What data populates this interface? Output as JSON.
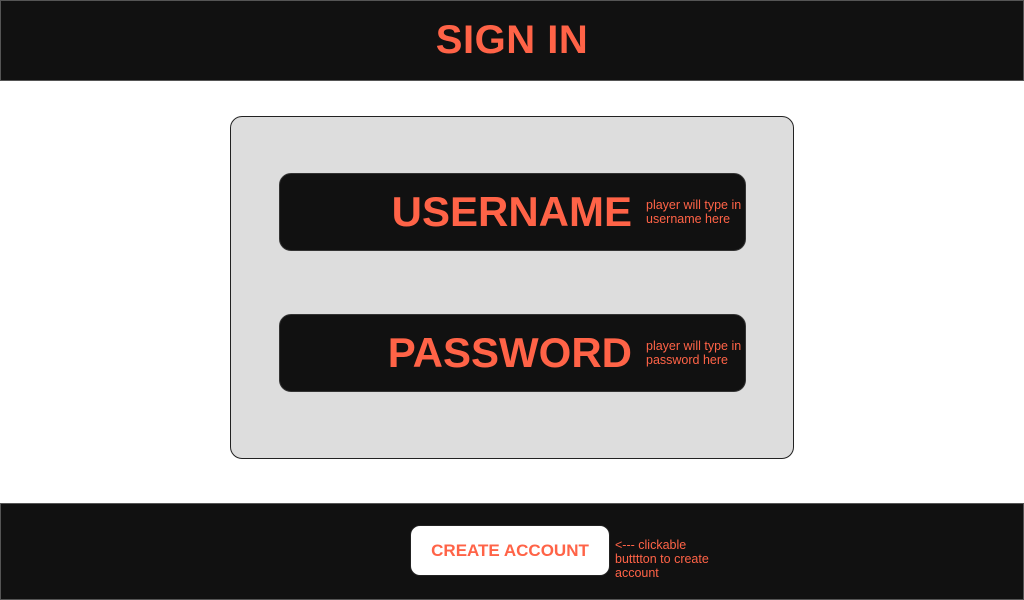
{
  "header": {
    "title": "SIGN IN"
  },
  "form": {
    "username": {
      "label": "USERNAME",
      "note": "player will type in username here"
    },
    "password": {
      "label": "PASSWORD",
      "note": "player will type in password here"
    }
  },
  "footer": {
    "create_account_label": "CREATE ACCOUNT",
    "create_account_note": "<--- clickable butttton to create account"
  },
  "colors": {
    "accent": "#ff6347",
    "dark": "#111111",
    "card": "#dddddd"
  }
}
